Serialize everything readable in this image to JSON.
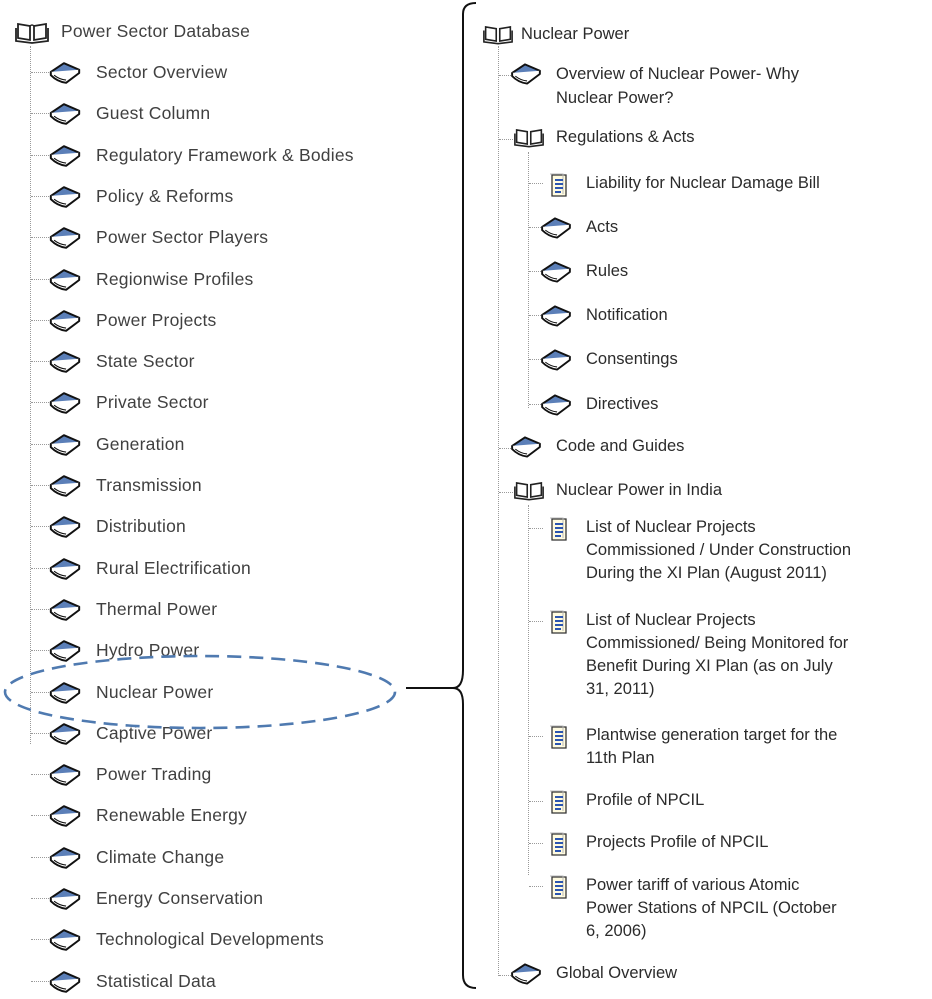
{
  "left_tree": {
    "root_label": "Power Sector Database",
    "items": [
      "Sector Overview",
      "Guest Column",
      "Regulatory Framework & Bodies",
      "Policy & Reforms",
      "Power Sector Players",
      "Regionwise Profiles",
      "Power Projects",
      "State Sector",
      "Private Sector",
      "Generation",
      "Transmission",
      "Distribution",
      "Rural Electrification",
      "Thermal Power",
      "Hydro Power",
      "Nuclear Power",
      "Captive Power",
      "Power Trading",
      "Renewable Energy",
      "Climate Change",
      "Energy Conservation",
      "Technological Developments",
      "Statistical Data"
    ],
    "highlighted_item": "Nuclear Power"
  },
  "right_tree": {
    "root_label": "Nuclear Power",
    "overview": [
      "Overview of Nuclear Power- Why",
      "Nuclear Power?"
    ],
    "regulations": {
      "label": "Regulations & Acts",
      "items": [
        {
          "icon": "document-icon",
          "label": "Liability for Nuclear Damage Bill"
        },
        {
          "icon": "book-icon",
          "label": "Acts"
        },
        {
          "icon": "book-icon",
          "label": "Rules"
        },
        {
          "icon": "book-icon",
          "label": "Notification"
        },
        {
          "icon": "book-icon",
          "label": "Consentings"
        },
        {
          "icon": "book-icon",
          "label": "Directives"
        }
      ]
    },
    "code_guides": "Code and Guides",
    "india": {
      "label": "Nuclear Power in India",
      "docs": [
        [
          "List of Nuclear Projects",
          "Commissioned / Under Construction",
          "During the XI Plan (August 2011)"
        ],
        [
          "List of Nuclear Projects",
          "Commissioned/ Being Monitored for",
          "Benefit During XI Plan (as on July",
          "31, 2011)"
        ],
        [
          "Plantwise generation target for the",
          "11th Plan"
        ],
        [
          "Profile of NPCIL"
        ],
        [
          "Projects Profile of NPCIL"
        ],
        [
          "Power tariff of various Atomic",
          "Power Stations of NPCIL (October",
          "6, 2006)"
        ]
      ]
    },
    "global": "Global Overview"
  },
  "colors": {
    "book_blue": "#5b7fb8",
    "highlight_dash": "#4f7ab0",
    "text": "#404040"
  }
}
